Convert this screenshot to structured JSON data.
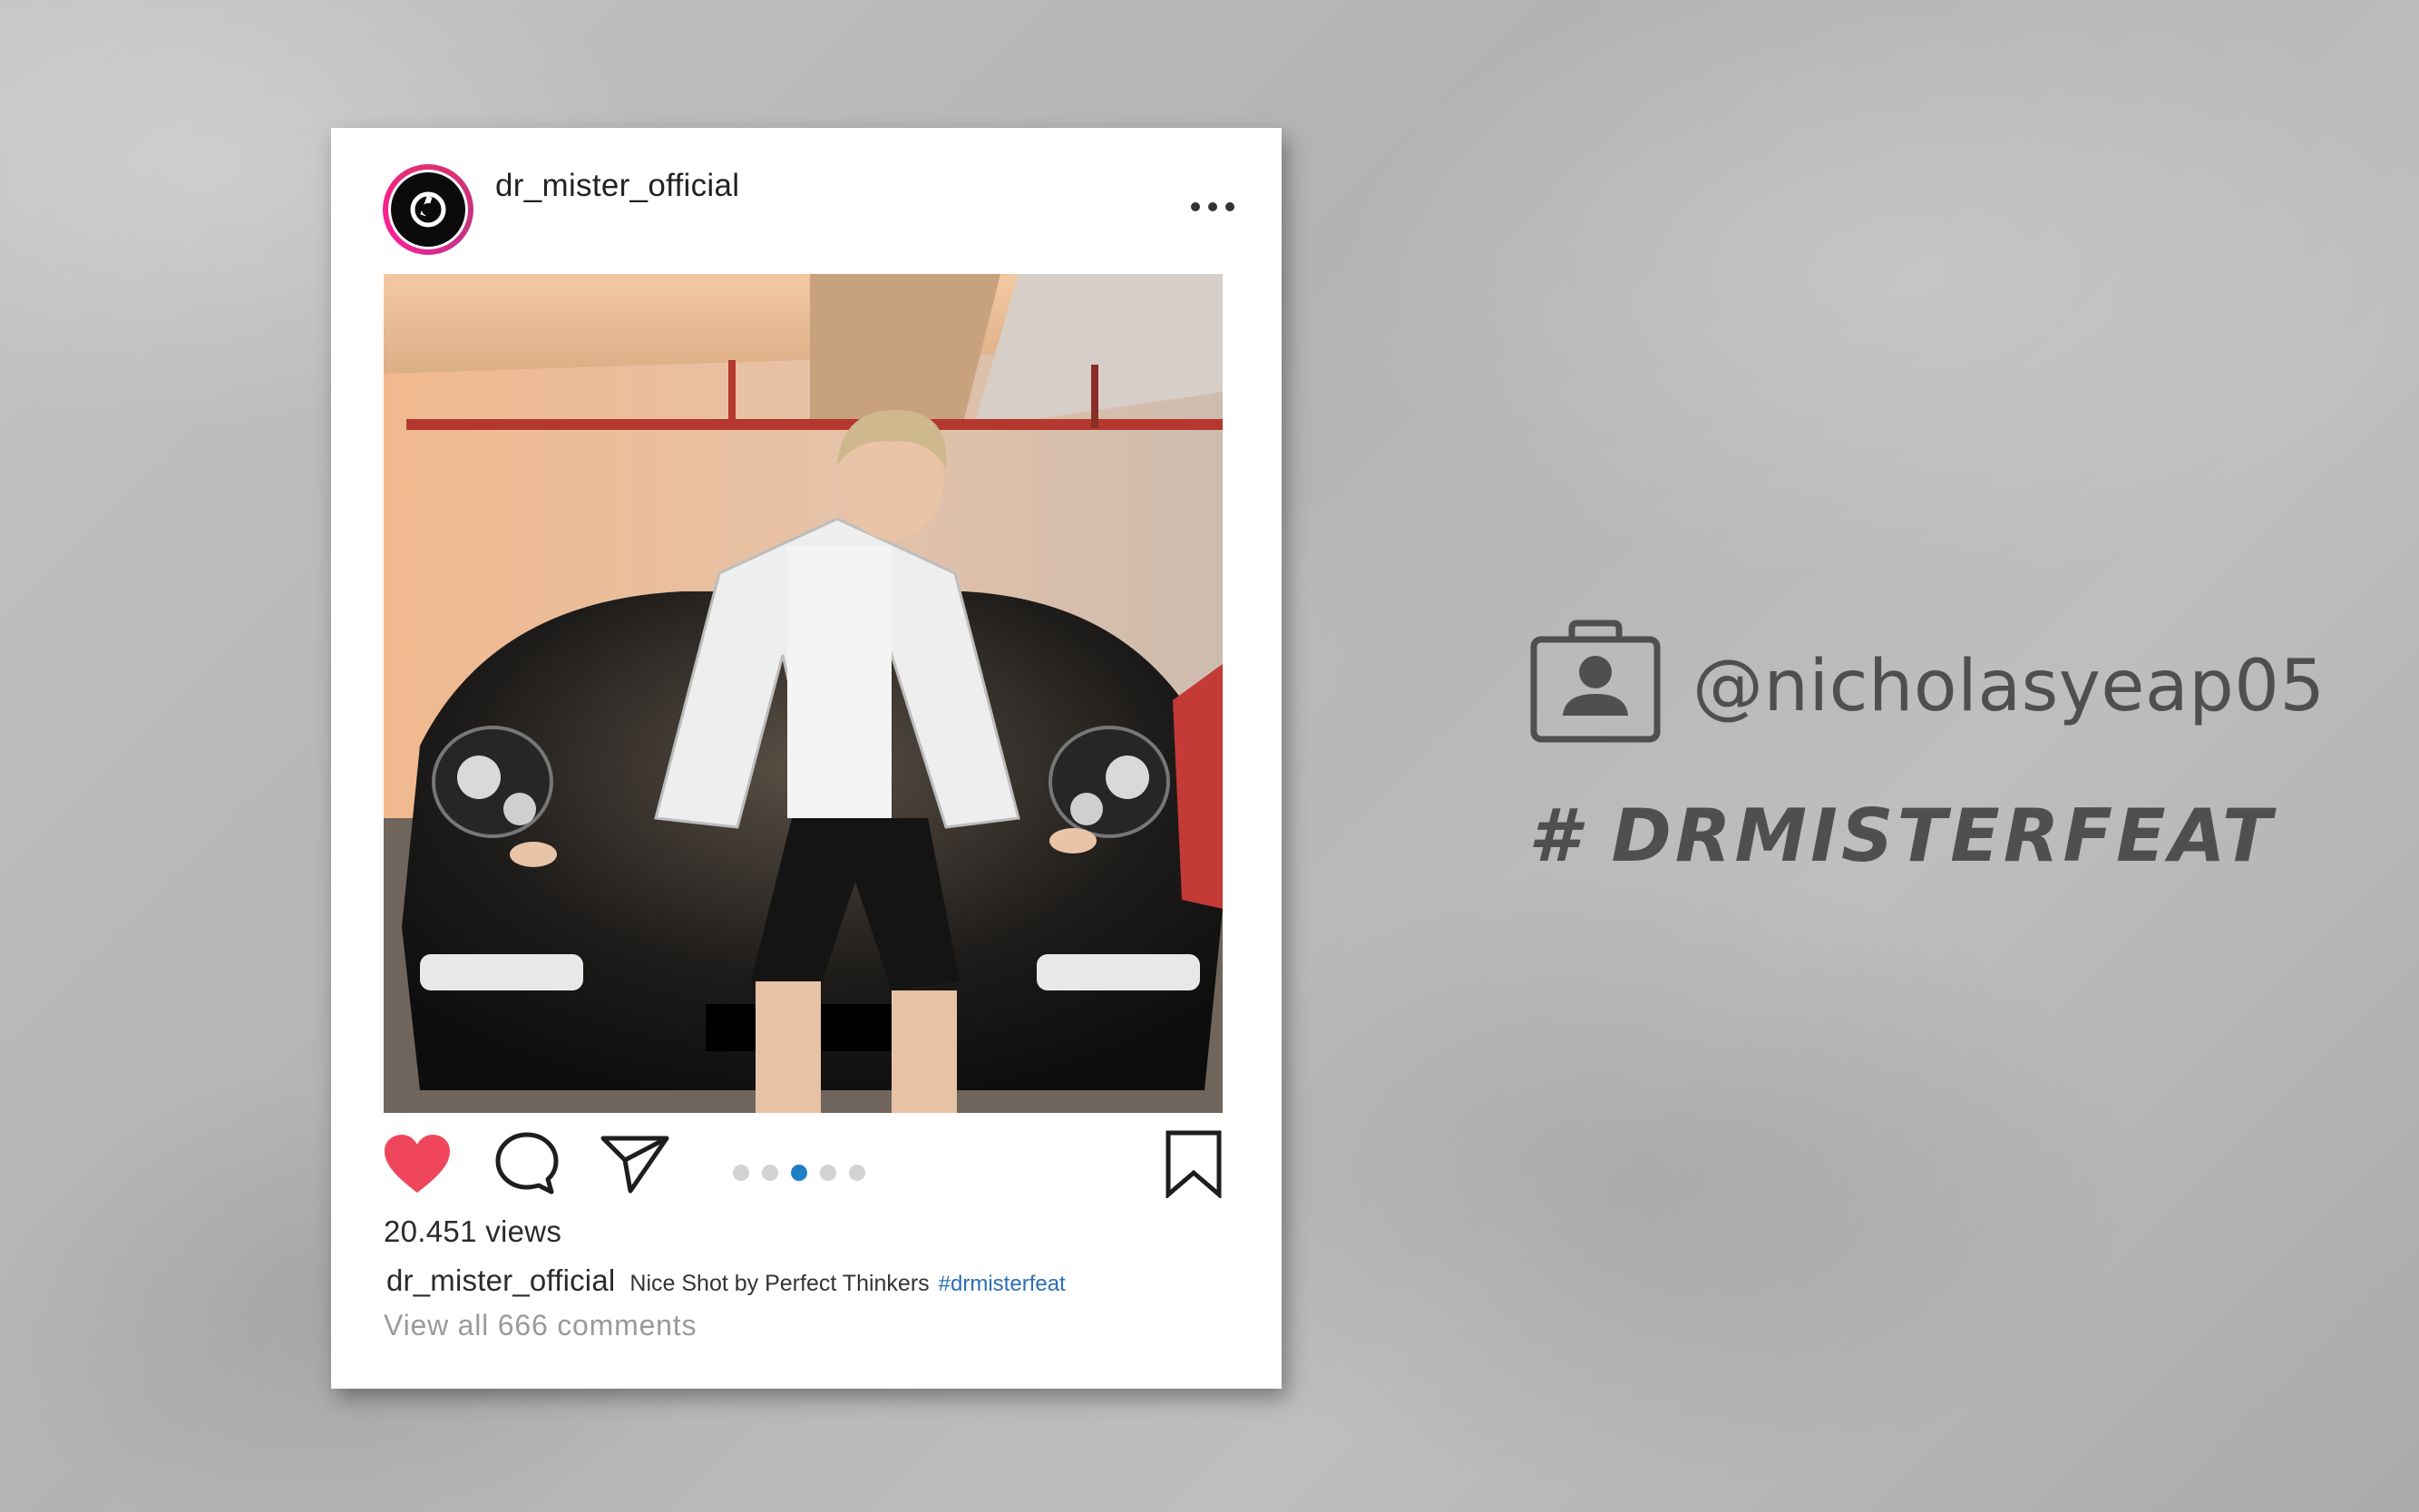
{
  "post": {
    "username": "dr_mister_official",
    "views": "20.451 views",
    "caption_user": "dr_mister_official",
    "caption_text": "Nice Shot by Perfect Thinkers",
    "caption_hashtag": "#drmisterfeat",
    "view_comments": "View all 666 comments",
    "carousel": {
      "total": 5,
      "active_index": 3
    },
    "liked": true,
    "colors": {
      "heart": "#f0465c",
      "active_dot": "#1f7fc6",
      "hashtag": "#2a6fb5",
      "avatar_ring": "#e1306c"
    },
    "icons": [
      "heart-icon",
      "comment-icon",
      "share-icon",
      "bookmark-icon",
      "more-icon"
    ]
  },
  "side": {
    "handle": "@nicholasyeap05",
    "hashtag": "# DRMISTERFEAT",
    "icon": "profile-card-icon"
  }
}
